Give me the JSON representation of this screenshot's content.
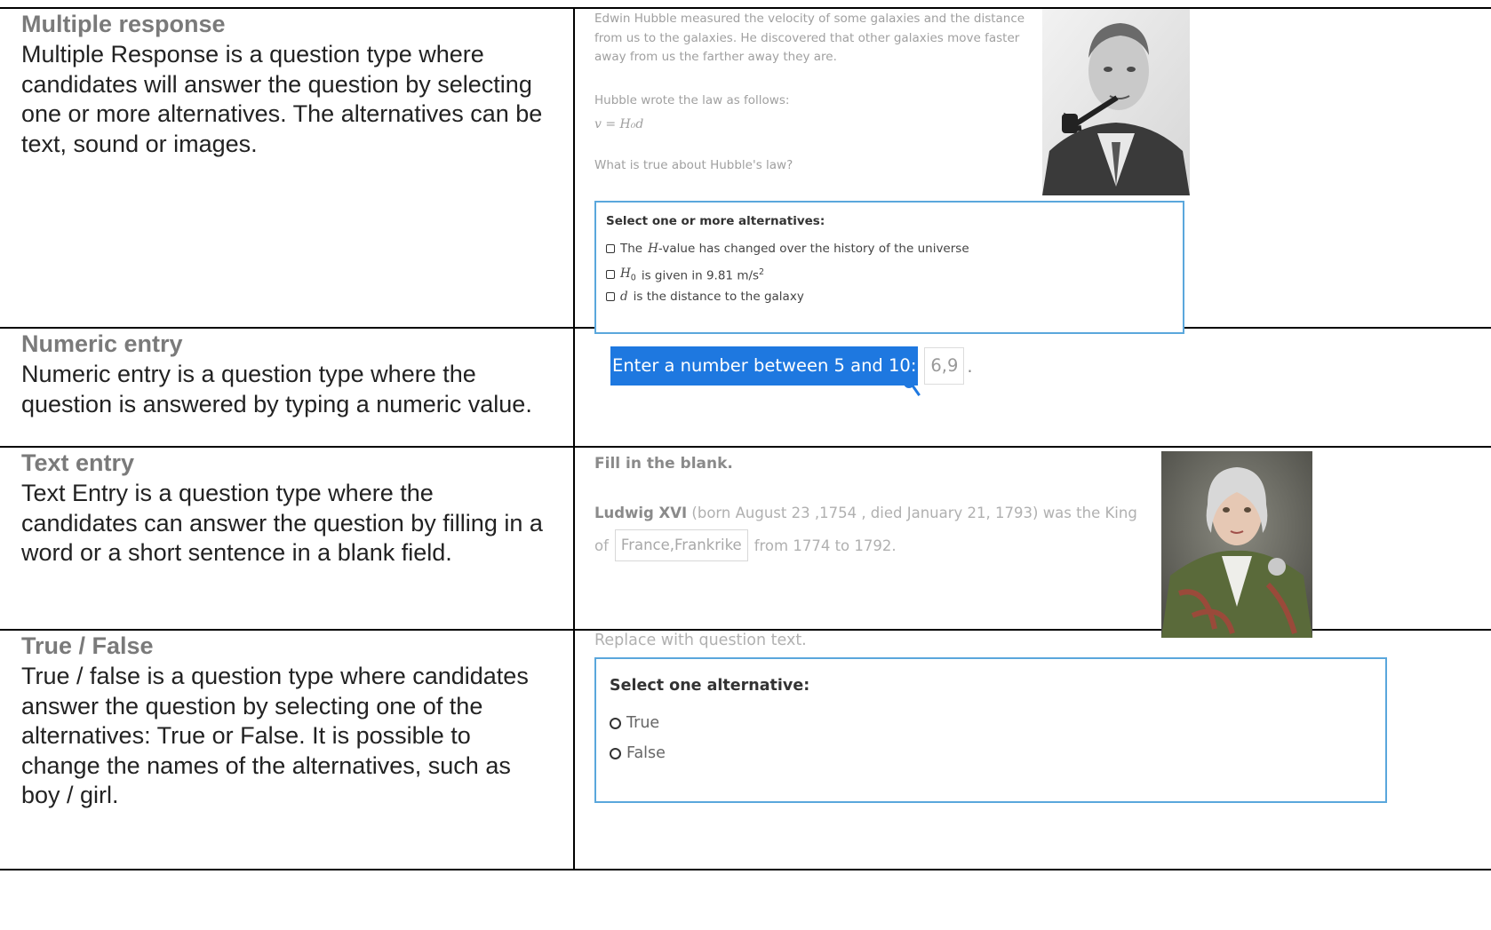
{
  "rows": [
    {
      "title": "Multiple response",
      "description": "Multiple Response is a question type where candidates will answer the question by selecting one or more alternatives. The alternatives can be text, sound or images."
    },
    {
      "title": "Numeric entry",
      "description": "Numeric entry is a question type where the question is answered by typing a numeric value."
    },
    {
      "title": "Text entry",
      "description": "Text Entry is a question type where the candidates can answer the question by filling in a word or a short sentence in a blank field."
    },
    {
      "title": "True / False",
      "description": "True / false is a question type where candidates answer the question by selecting one of the alternatives: True or False. It is possible to change the names of the alternatives, such as boy / girl."
    }
  ],
  "multiple_response": {
    "intro": "Edwin Hubble measured the velocity of some galaxies and the distance from us to the galaxies. He discovered that other galaxies move faster away from us the farther away they are.",
    "law_label": "Hubble wrote the law as follows:",
    "formula": "v = H₀d",
    "question": "What is true about Hubble's law?",
    "instruction": "Select one or more alternatives:",
    "options": {
      "opt1_var": "H",
      "opt1_text": "-value has changed over the history of the universe",
      "opt1_prefix": "The",
      "opt2_var": "H",
      "opt2_sub": "0",
      "opt2_text": "is given in 9.81 m/s",
      "opt2_sup": "2",
      "opt3_var": "d",
      "opt3_text": "is the distance to the galaxy"
    }
  },
  "numeric_entry": {
    "prompt": "Enter a number between 5 and 10:",
    "value": "6,9",
    "suffix": "."
  },
  "text_entry": {
    "title": "Fill in the blank.",
    "name": "Ludwig XVI",
    "line1_rest": "(born August 23 ,1754 , died January 21, 1793) was the King",
    "line2_prefix": "of",
    "value": "France,Frankrike",
    "line2_suffix": "from 1774 to 1792."
  },
  "true_false": {
    "question": "Replace with question text.",
    "instruction": "Select one alternative:",
    "option_true": "True",
    "option_false": "False"
  },
  "colors": {
    "border": "#000000",
    "title_gray": "#7a7a7a",
    "box_border": "#5aa7dc",
    "highlight": "#1e78e0"
  }
}
